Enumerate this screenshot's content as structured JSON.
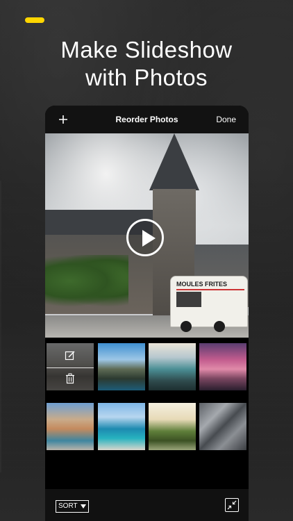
{
  "headline": {
    "line1": "Make Slideshow",
    "line2": "with Photos"
  },
  "colors": {
    "accent": "#ffd600",
    "background": "#232323",
    "nav_background": "#121212",
    "text": "#ffffff"
  },
  "navbar": {
    "add_icon": "plus-icon",
    "title": "Reorder Photos",
    "done_label": "Done"
  },
  "preview": {
    "play_icon": "play-icon",
    "van_sign": "MOULES FRITES"
  },
  "thumbnails": [
    {
      "name": "photo-church",
      "selected": true,
      "actions": [
        "edit-icon",
        "trash-icon"
      ]
    },
    {
      "name": "photo-mountain-lake",
      "selected": false
    },
    {
      "name": "photo-glacier-peaks",
      "selected": false
    },
    {
      "name": "photo-pink-sunset-pier",
      "selected": false
    },
    {
      "name": "photo-harbor-town",
      "selected": false
    },
    {
      "name": "photo-ocean-pool",
      "selected": false
    },
    {
      "name": "photo-palm-coast",
      "selected": false
    },
    {
      "name": "photo-city-aerial",
      "selected": false
    }
  ],
  "bottom_bar": {
    "sort_label": "SORT",
    "sort_icon": "caret-down-icon",
    "collapse_icon": "collapse-arrows-icon"
  }
}
